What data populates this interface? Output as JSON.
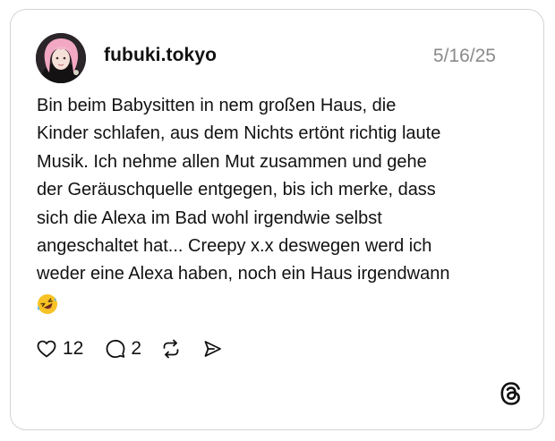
{
  "post": {
    "username": "fubuki.tokyo",
    "date": "5/16/25",
    "text": "Bin beim Babysitten in nem großen Haus, die\nKinder schlafen, aus dem Nichts ertönt richtig laute\nMusik. Ich nehme allen Mut zusammen und gehe\nder Geräuschquelle entgegen, bis ich merke, dass\nsich die Alexa im Bad wohl irgendwie selbst\nangeschaltet hat... Creepy x.x deswegen werd ich\nweder eine Alexa haben, noch ein Haus irgendwann",
    "emoji": "rolling-on-the-floor-laughing-emoji",
    "avatar": "user-avatar-photo"
  },
  "actions": {
    "like_count": "12",
    "reply_count": "2",
    "like_icon": "heart-icon",
    "reply_icon": "comment-icon",
    "repost_icon": "repost-icon",
    "share_icon": "send-icon"
  },
  "brand": {
    "logo": "threads-logo"
  }
}
